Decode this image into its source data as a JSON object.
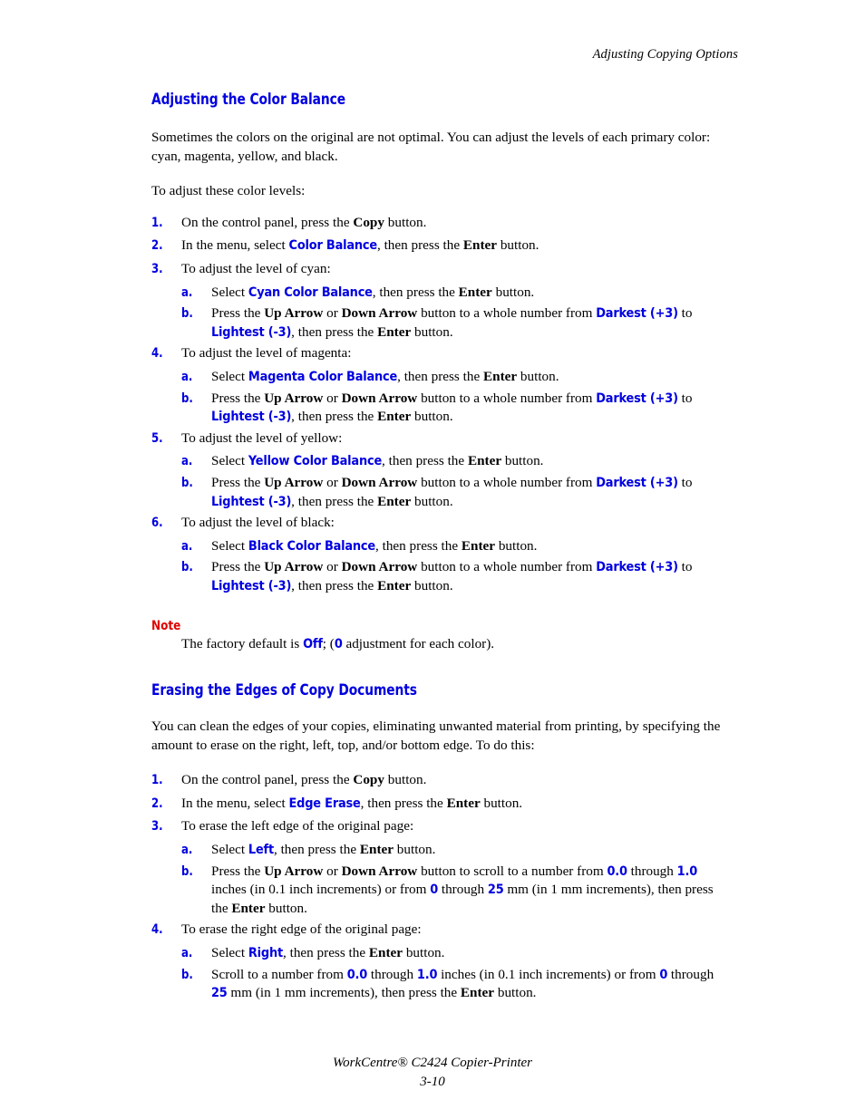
{
  "header": {
    "running_head": "Adjusting Copying Options"
  },
  "footer": {
    "product": "WorkCentre® C2424 Copier-Printer",
    "page_number": "3-10"
  },
  "colors": {
    "heading_blue": "#0000E0",
    "ui_blue": "#0000E0",
    "note_red": "#E00000",
    "body_black": "#000000",
    "page_background": "#FFFFFF"
  },
  "sections": [
    {
      "id": "color-balance",
      "heading": "Adjusting the Color Balance",
      "intro": "Sometimes the colors on the original are not optimal. You can adjust the levels of each primary color: cyan, magenta, yellow, and black.",
      "lead_in": "To adjust these color levels:",
      "steps": [
        {
          "marker": "1.",
          "text_1": "On the control panel, press the ",
          "bold_1": "Copy",
          "text_2": " button."
        },
        {
          "marker": "2.",
          "text_1": "In the menu, select ",
          "ui_1": "Color Balance",
          "text_2": ", then press the ",
          "bold_1": "Enter",
          "text_3": " button."
        },
        {
          "marker": "3.",
          "text_1": "To adjust the level of cyan:"
        },
        {
          "marker": "4.",
          "text_1": "To adjust the level of magenta:"
        },
        {
          "marker": "5.",
          "text_1": "To adjust the level of yellow:"
        },
        {
          "marker": "6.",
          "text_1": "To adjust the level of black:"
        }
      ],
      "substeps": {
        "cyan": {
          "a": {
            "marker": "a.",
            "text_1": "Select ",
            "ui_1": "Cyan Color Balance",
            "text_2": ", then press the ",
            "bold_1": "Enter",
            "text_3": " button."
          },
          "b": {
            "marker": "b.",
            "text_1": "Press the ",
            "bold_1": "Up Arrow",
            "text_2": " or ",
            "bold_2": "Down Arrow",
            "text_3": " button to a whole number from ",
            "ui_1": "Darkest (+3)",
            "text_4": " to ",
            "ui_2": "Lightest (-3)",
            "text_5": ", then press the ",
            "bold_3": "Enter",
            "text_6": " button."
          }
        },
        "magenta": {
          "a": {
            "marker": "a.",
            "text_1": "Select ",
            "ui_1": "Magenta Color Balance",
            "text_2": ", then press the ",
            "bold_1": "Enter",
            "text_3": " button."
          },
          "b": {
            "marker": "b.",
            "text_1": "Press the ",
            "bold_1": "Up Arrow",
            "text_2": " or ",
            "bold_2": "Down Arrow",
            "text_3": " button to a whole number from ",
            "ui_1": "Darkest (+3)",
            "text_4": " to ",
            "ui_2": "Lightest (-3)",
            "text_5": ", then press the ",
            "bold_3": "Enter",
            "text_6": " button."
          }
        },
        "yellow": {
          "a": {
            "marker": "a.",
            "text_1": "Select ",
            "ui_1": "Yellow Color Balance",
            "text_2": ", then press the ",
            "bold_1": "Enter",
            "text_3": " button."
          },
          "b": {
            "marker": "b.",
            "text_1": "Press the ",
            "bold_1": "Up Arrow",
            "text_2": " or ",
            "bold_2": "Down Arrow",
            "text_3": " button to a whole number from ",
            "ui_1": "Darkest (+3)",
            "text_4": " to ",
            "ui_2": "Lightest (-3)",
            "text_5": ", then press the ",
            "bold_3": "Enter",
            "text_6": " button."
          }
        },
        "black": {
          "a": {
            "marker": "a.",
            "text_1": "Select ",
            "ui_1": "Black Color Balance",
            "text_2": ", then press the ",
            "bold_1": "Enter",
            "text_3": " button."
          },
          "b": {
            "marker": "b.",
            "text_1": "Press the ",
            "bold_1": "Up Arrow",
            "text_2": " or ",
            "bold_2": "Down Arrow",
            "text_3": " button to a whole number from ",
            "ui_1": "Darkest (+3)",
            "text_4": " to ",
            "ui_2": "Lightest (-3)",
            "text_5": ", then press the ",
            "bold_3": "Enter",
            "text_6": " button."
          }
        }
      },
      "note": {
        "label": "Note",
        "text_1": "The factory default is ",
        "ui_1": "Off",
        "text_2": "; (",
        "ui_2": "0",
        "text_3": " adjustment for each color)."
      }
    },
    {
      "id": "edge-erase",
      "heading": "Erasing the Edges of Copy Documents",
      "intro": "You can clean the edges of your copies, eliminating unwanted material from printing, by specifying the amount to erase on the right, left, top, and/or bottom edge. To do this:",
      "steps": [
        {
          "marker": "1.",
          "text_1": "On the control panel, press the ",
          "bold_1": "Copy",
          "text_2": " button."
        },
        {
          "marker": "2.",
          "text_1": "In the menu, select ",
          "ui_1": "Edge Erase",
          "text_2": ", then press the ",
          "bold_1": "Enter",
          "text_3": " button."
        },
        {
          "marker": "3.",
          "text_1": "To erase the left edge of the original page:"
        },
        {
          "marker": "4.",
          "text_1": "To erase the right edge of the original page:"
        }
      ],
      "substeps": {
        "left": {
          "a": {
            "marker": "a.",
            "text_1": "Select ",
            "ui_1": "Left",
            "text_2": ", then press the ",
            "bold_1": "Enter",
            "text_3": " button."
          },
          "b": {
            "marker": "b.",
            "text_1": "Press the ",
            "bold_1": "Up Arrow",
            "text_2": " or ",
            "bold_2": "Down Arrow",
            "text_3": " button to scroll to a number from ",
            "ui_1": "0.0",
            "text_4": " through ",
            "ui_2": "1.0",
            "text_5": " inches (in 0.1 inch increments) or from ",
            "ui_3": "0",
            "text_6": " through ",
            "ui_4": "25",
            "text_7": " mm (in 1 mm increments), then press the ",
            "bold_3": "Enter",
            "text_8": " button."
          }
        },
        "right": {
          "a": {
            "marker": "a.",
            "text_1": "Select ",
            "ui_1": "Right",
            "text_2": ", then press the ",
            "bold_1": "Enter",
            "text_3": " button."
          },
          "b": {
            "marker": "b.",
            "text_1": "Scroll to a number from ",
            "ui_1": "0.0",
            "text_2": " through ",
            "ui_2": "1.0",
            "text_3": " inches (in 0.1 inch increments) or from ",
            "ui_3": "0",
            "text_4": " through ",
            "ui_4": "25",
            "text_5": " mm (in 1 mm increments), then press the ",
            "bold_1": "Enter",
            "text_6": " button."
          }
        }
      }
    }
  ]
}
